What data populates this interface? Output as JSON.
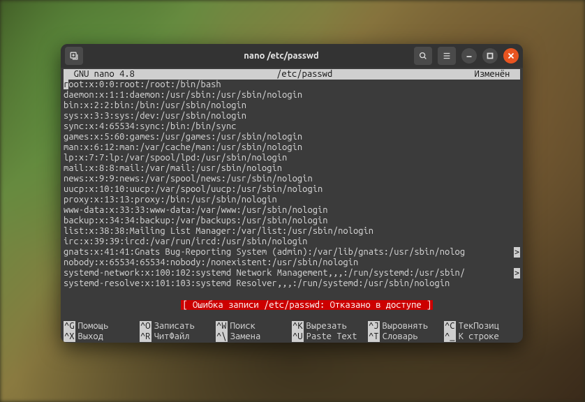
{
  "window": {
    "title": "nano /etc/passwd"
  },
  "nano": {
    "version_line_left": "  GNU nano 4.8",
    "filename": "/etc/passwd",
    "modified_label": "Изменён",
    "status_message": "[ Ошибка записи /etc/passwd: Отказано в доступе ]",
    "lines": [
      "root:x:0:0:root:/root:/bin/bash",
      "daemon:x:1:1:daemon:/usr/sbin:/usr/sbin/nologin",
      "bin:x:2:2:bin:/bin:/usr/sbin/nologin",
      "sys:x:3:3:sys:/dev:/usr/sbin/nologin",
      "sync:x:4:65534:sync:/bin:/bin/sync",
      "games:x:5:60:games:/usr/games:/usr/sbin/nologin",
      "man:x:6:12:man:/var/cache/man:/usr/sbin/nologin",
      "lp:x:7:7:lp:/var/spool/lpd:/usr/sbin/nologin",
      "mail:x:8:8:mail:/var/mail:/usr/sbin/nologin",
      "news:x:9:9:news:/var/spool/news:/usr/sbin/nologin",
      "uucp:x:10:10:uucp:/var/spool/uucp:/usr/sbin/nologin",
      "proxy:x:13:13:proxy:/bin:/usr/sbin/nologin",
      "www-data:x:33:33:www-data:/var/www:/usr/sbin/nologin",
      "backup:x:34:34:backup:/var/backups:/usr/sbin/nologin",
      "list:x:38:38:Mailing List Manager:/var/list:/usr/sbin/nologin",
      "irc:x:39:39:ircd:/var/run/ircd:/usr/sbin/nologin",
      "gnats:x:41:41:Gnats Bug-Reporting System (admin):/var/lib/gnats:/usr/sbin/nolog",
      "nobody:x:65534:65534:nobody:/nonexistent:/usr/sbin/nologin",
      "systemd-network:x:100:102:systemd Network Management,,,:/run/systemd:/usr/sbin/",
      "systemd-resolve:x:101:103:systemd Resolver,,,:/run/systemd:/usr/sbin/nologin"
    ],
    "overflow_lines": [
      16,
      18
    ],
    "cursor_line": 0,
    "shortcuts": [
      {
        "key": "^G",
        "label": "Помощь"
      },
      {
        "key": "^O",
        "label": "Записать"
      },
      {
        "key": "^W",
        "label": "Поиск"
      },
      {
        "key": "^K",
        "label": "Вырезать"
      },
      {
        "key": "^J",
        "label": "Выровнять"
      },
      {
        "key": "^C",
        "label": "ТекПозиц"
      },
      {
        "key": "^X",
        "label": "Выход"
      },
      {
        "key": "^R",
        "label": "ЧитФайл"
      },
      {
        "key": "^\\",
        "label": "Замена"
      },
      {
        "key": "^U",
        "label": "Paste Text"
      },
      {
        "key": "^T",
        "label": "Словарь"
      },
      {
        "key": "^_",
        "label": "К строке"
      }
    ]
  },
  "icons": {
    "new_tab": "new-tab-icon",
    "search": "search-icon",
    "menu": "hamburger-icon",
    "minimize": "minimize-icon",
    "maximize": "maximize-icon",
    "close": "close-icon"
  }
}
